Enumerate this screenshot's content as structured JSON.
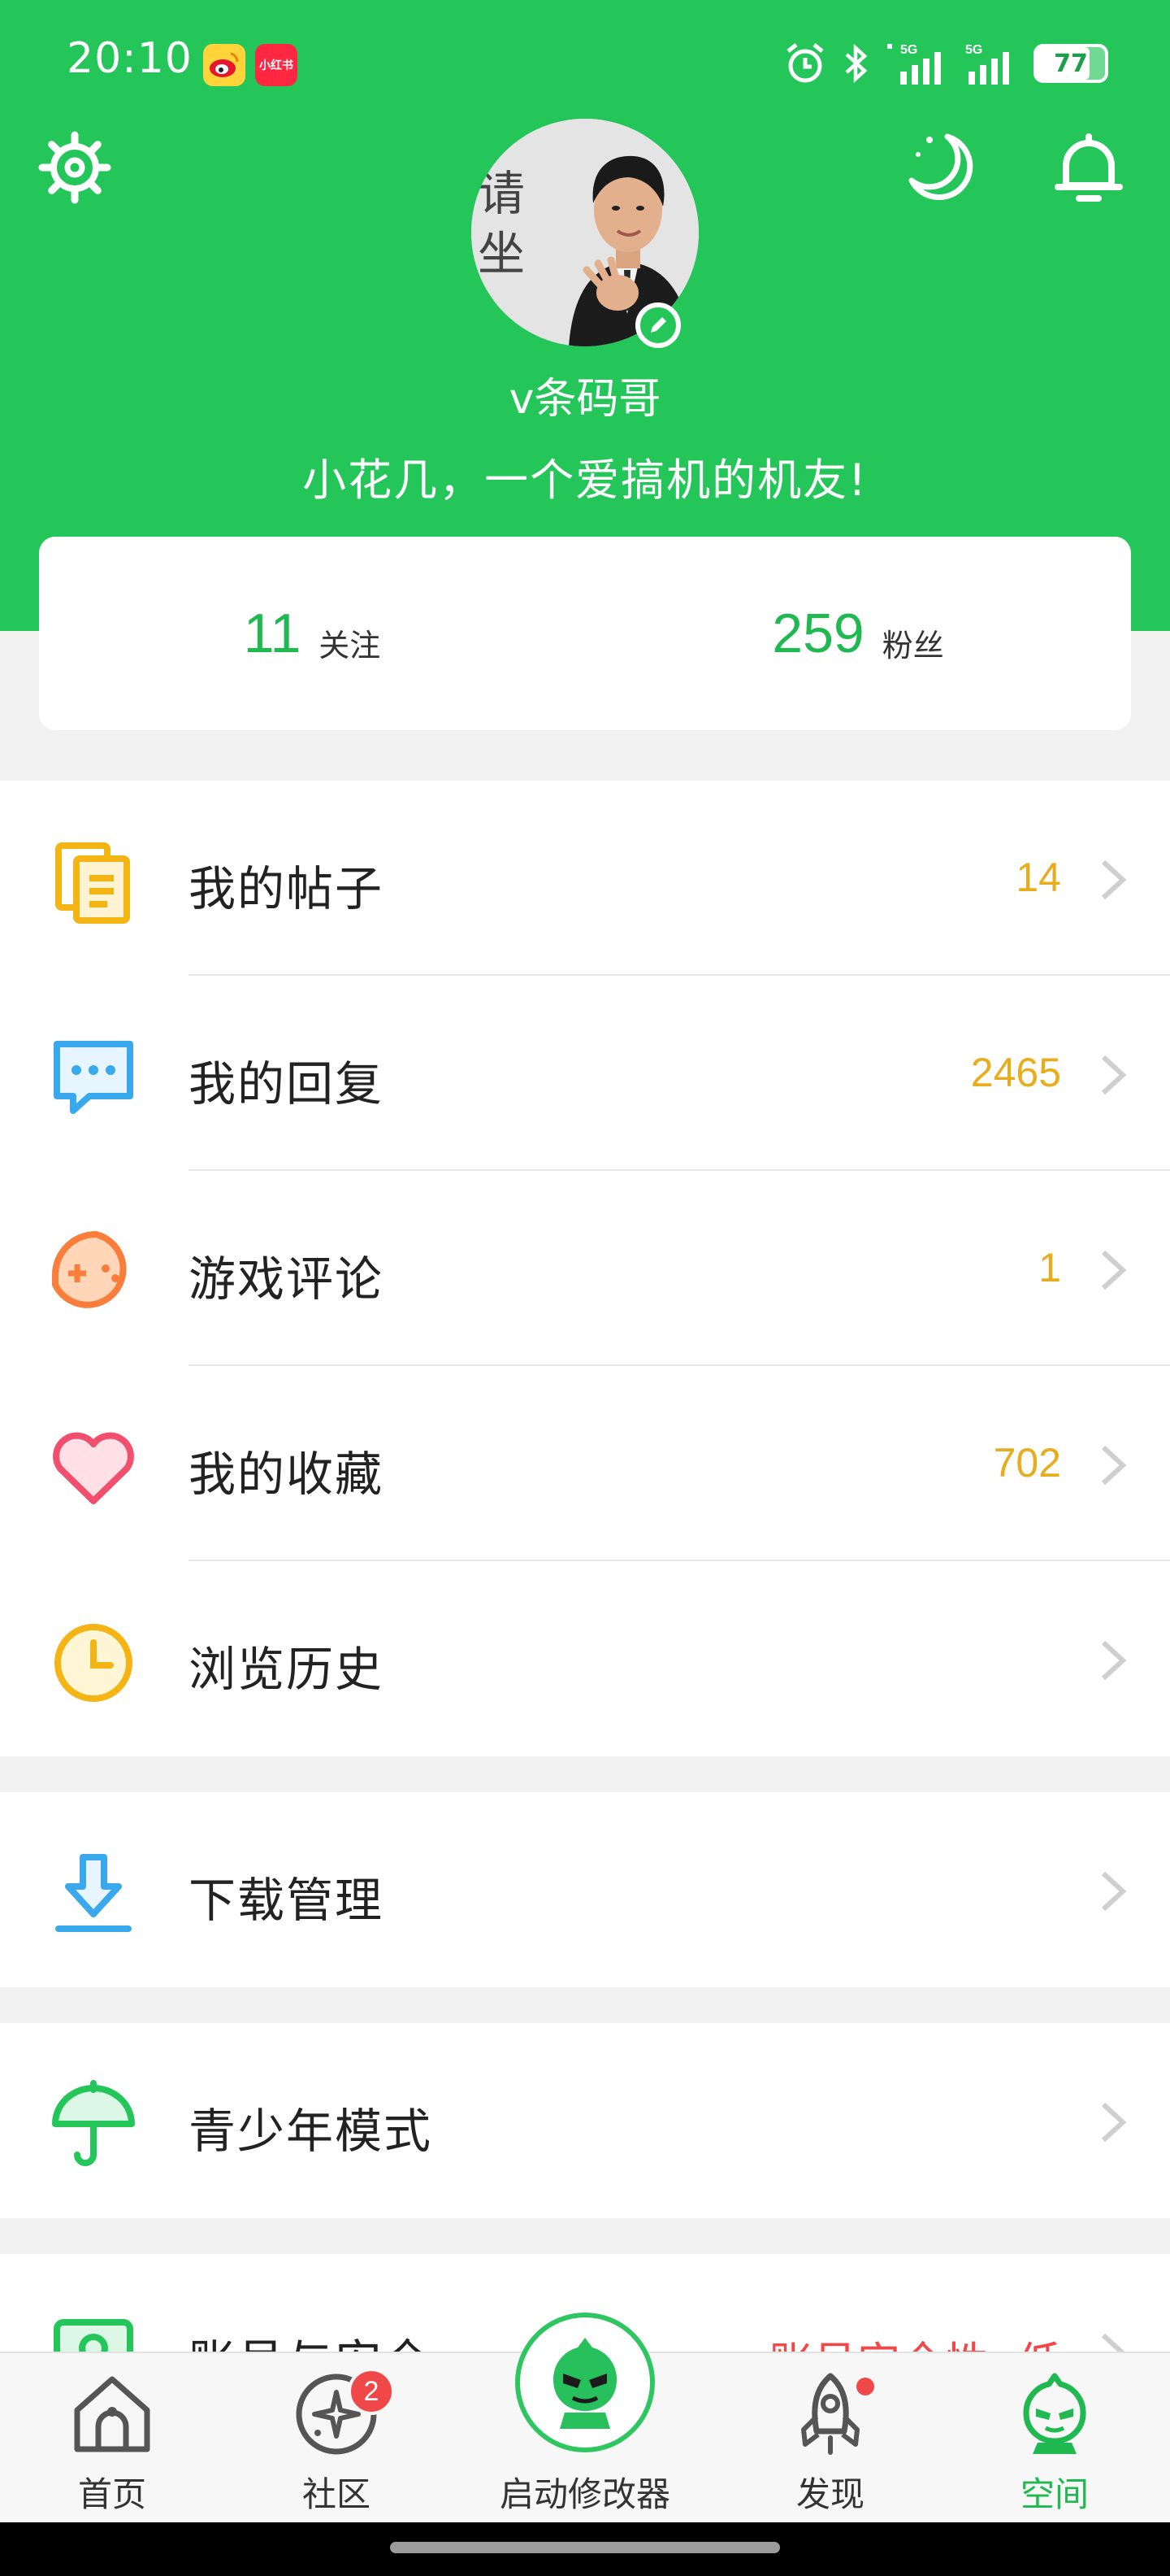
{
  "status_bar": {
    "time": "20:10",
    "app_badges": [
      "weibo-icon",
      "xiaohongshu-icon"
    ],
    "xhs_text": "小红书",
    "signal_labels": [
      "5G",
      "5G"
    ],
    "battery": "77"
  },
  "header": {
    "icons": [
      "settings-icon",
      "moon-icon",
      "bell-icon"
    ],
    "avatar_text": [
      "请",
      "坐"
    ],
    "username": "v条码哥",
    "bio": "小花几，一个爱搞机的机友!"
  },
  "stats": {
    "following": {
      "value": "11",
      "label": "关注"
    },
    "followers": {
      "value": "259",
      "label": "粉丝"
    }
  },
  "menu": {
    "posts": {
      "label": "我的帖子",
      "count": "14"
    },
    "replies": {
      "label": "我的回复",
      "count": "2465"
    },
    "reviews": {
      "label": "游戏评论",
      "count": "1"
    },
    "favorites": {
      "label": "我的收藏",
      "count": "702"
    },
    "history": {
      "label": "浏览历史"
    },
    "downloads": {
      "label": "下载管理"
    },
    "teen_mode": {
      "label": "青少年模式"
    },
    "account": {
      "label": "账号与安全",
      "status": "账号安全性: 低"
    }
  },
  "bottom_nav": {
    "home": "首页",
    "community": "社区",
    "community_badge": "2",
    "launcher": "启动修改器",
    "discover": "发现",
    "space": "空间"
  },
  "colors": {
    "brand_green": "#24c65a",
    "count_yellow": "#e8ad1c",
    "alert_red": "#f04848"
  }
}
